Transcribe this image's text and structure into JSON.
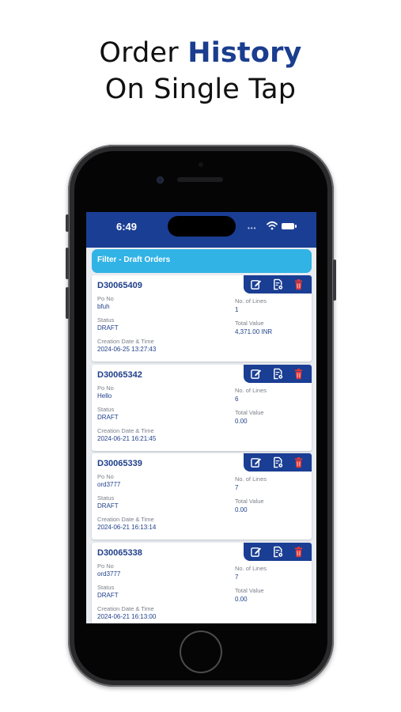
{
  "headline": {
    "line1_plain": "Order ",
    "line1_accent": "History",
    "line2": "On Single Tap"
  },
  "status_bar": {
    "time": "6:49",
    "dots": "•••"
  },
  "filter": {
    "label": "Filter - Draft Orders"
  },
  "field_labels": {
    "po_no": "Po No",
    "status": "Status",
    "created": "Creation Date & Time",
    "lines": "No. of Lines",
    "total": "Total Value"
  },
  "orders": [
    {
      "id": "D30065409",
      "po_no": "bfuh",
      "status": "DRAFT",
      "created": "2024-06-25 13:27:43",
      "lines": "1",
      "total": "4,371.00 INR"
    },
    {
      "id": "D30065342",
      "po_no": "Hello",
      "status": "DRAFT",
      "created": "2024-06-21 16:21:45",
      "lines": "6",
      "total": "0.00"
    },
    {
      "id": "D30065339",
      "po_no": "ord3777",
      "status": "DRAFT",
      "created": "2024-06-21 16:13:14",
      "lines": "7",
      "total": "0.00"
    },
    {
      "id": "D30065338",
      "po_no": "ord3777",
      "status": "DRAFT",
      "created": "2024-06-21 16:13:00",
      "lines": "7",
      "total": "0.00"
    }
  ],
  "icons": {
    "edit": "edit-icon",
    "view": "document-view-icon",
    "delete": "trash-icon"
  },
  "colors": {
    "brand": "#1a3e94",
    "filter": "#31b3e6",
    "delete": "#e53935",
    "accent_text": "#1a3d8f"
  }
}
